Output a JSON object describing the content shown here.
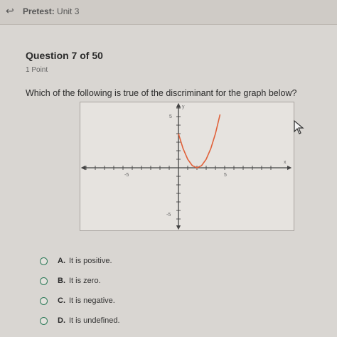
{
  "topbar": {
    "back_icon": "back-arrow-icon",
    "label_prefix": "Pretest:",
    "label_unit": "Unit 3"
  },
  "question": {
    "title": "Question 7 of 50",
    "points": "1 Point",
    "text": "Which of the following is true of the discriminant for the graph below?"
  },
  "graph": {
    "x_label": "x",
    "y_label": "y",
    "tick_labels": {
      "y_pos": "5",
      "y_neg": "-5",
      "x_neg": "-5",
      "x_pos": "5"
    }
  },
  "chart_data": {
    "type": "line",
    "title": "",
    "xlabel": "x",
    "ylabel": "y",
    "xlim": [
      -10,
      10
    ],
    "ylim": [
      -7,
      7
    ],
    "grid": false,
    "series": [
      {
        "color": "#e0613a",
        "x": [
          0,
          0.5,
          1,
          1.5,
          2,
          2.5,
          3,
          3.5,
          4,
          4.5
        ],
        "y": [
          4,
          2.25,
          1,
          0.25,
          0,
          0.25,
          1,
          2.25,
          4,
          6.25
        ]
      }
    ]
  },
  "choices": [
    {
      "letter": "A.",
      "text": "It is positive."
    },
    {
      "letter": "B.",
      "text": "It is zero."
    },
    {
      "letter": "C.",
      "text": "It is negative."
    },
    {
      "letter": "D.",
      "text": "It is undefined."
    }
  ],
  "colors": {
    "accent": "#2e7a5a",
    "curve": "#e0613a"
  }
}
